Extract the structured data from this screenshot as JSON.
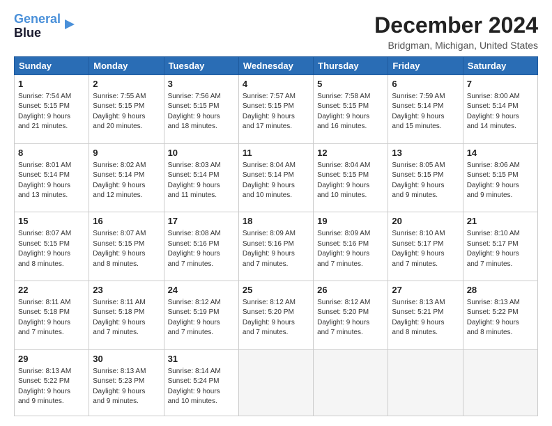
{
  "logo": {
    "line1": "General",
    "line2": "Blue"
  },
  "title": "December 2024",
  "subtitle": "Bridgman, Michigan, United States",
  "headers": [
    "Sunday",
    "Monday",
    "Tuesday",
    "Wednesday",
    "Thursday",
    "Friday",
    "Saturday"
  ],
  "weeks": [
    [
      {
        "day": "1",
        "lines": [
          "Sunrise: 7:54 AM",
          "Sunset: 5:15 PM",
          "Daylight: 9 hours",
          "and 21 minutes."
        ]
      },
      {
        "day": "2",
        "lines": [
          "Sunrise: 7:55 AM",
          "Sunset: 5:15 PM",
          "Daylight: 9 hours",
          "and 20 minutes."
        ]
      },
      {
        "day": "3",
        "lines": [
          "Sunrise: 7:56 AM",
          "Sunset: 5:15 PM",
          "Daylight: 9 hours",
          "and 18 minutes."
        ]
      },
      {
        "day": "4",
        "lines": [
          "Sunrise: 7:57 AM",
          "Sunset: 5:15 PM",
          "Daylight: 9 hours",
          "and 17 minutes."
        ]
      },
      {
        "day": "5",
        "lines": [
          "Sunrise: 7:58 AM",
          "Sunset: 5:15 PM",
          "Daylight: 9 hours",
          "and 16 minutes."
        ]
      },
      {
        "day": "6",
        "lines": [
          "Sunrise: 7:59 AM",
          "Sunset: 5:14 PM",
          "Daylight: 9 hours",
          "and 15 minutes."
        ]
      },
      {
        "day": "7",
        "lines": [
          "Sunrise: 8:00 AM",
          "Sunset: 5:14 PM",
          "Daylight: 9 hours",
          "and 14 minutes."
        ]
      }
    ],
    [
      {
        "day": "8",
        "lines": [
          "Sunrise: 8:01 AM",
          "Sunset: 5:14 PM",
          "Daylight: 9 hours",
          "and 13 minutes."
        ]
      },
      {
        "day": "9",
        "lines": [
          "Sunrise: 8:02 AM",
          "Sunset: 5:14 PM",
          "Daylight: 9 hours",
          "and 12 minutes."
        ]
      },
      {
        "day": "10",
        "lines": [
          "Sunrise: 8:03 AM",
          "Sunset: 5:14 PM",
          "Daylight: 9 hours",
          "and 11 minutes."
        ]
      },
      {
        "day": "11",
        "lines": [
          "Sunrise: 8:04 AM",
          "Sunset: 5:14 PM",
          "Daylight: 9 hours",
          "and 10 minutes."
        ]
      },
      {
        "day": "12",
        "lines": [
          "Sunrise: 8:04 AM",
          "Sunset: 5:15 PM",
          "Daylight: 9 hours",
          "and 10 minutes."
        ]
      },
      {
        "day": "13",
        "lines": [
          "Sunrise: 8:05 AM",
          "Sunset: 5:15 PM",
          "Daylight: 9 hours",
          "and 9 minutes."
        ]
      },
      {
        "day": "14",
        "lines": [
          "Sunrise: 8:06 AM",
          "Sunset: 5:15 PM",
          "Daylight: 9 hours",
          "and 9 minutes."
        ]
      }
    ],
    [
      {
        "day": "15",
        "lines": [
          "Sunrise: 8:07 AM",
          "Sunset: 5:15 PM",
          "Daylight: 9 hours",
          "and 8 minutes."
        ]
      },
      {
        "day": "16",
        "lines": [
          "Sunrise: 8:07 AM",
          "Sunset: 5:15 PM",
          "Daylight: 9 hours",
          "and 8 minutes."
        ]
      },
      {
        "day": "17",
        "lines": [
          "Sunrise: 8:08 AM",
          "Sunset: 5:16 PM",
          "Daylight: 9 hours",
          "and 7 minutes."
        ]
      },
      {
        "day": "18",
        "lines": [
          "Sunrise: 8:09 AM",
          "Sunset: 5:16 PM",
          "Daylight: 9 hours",
          "and 7 minutes."
        ]
      },
      {
        "day": "19",
        "lines": [
          "Sunrise: 8:09 AM",
          "Sunset: 5:16 PM",
          "Daylight: 9 hours",
          "and 7 minutes."
        ]
      },
      {
        "day": "20",
        "lines": [
          "Sunrise: 8:10 AM",
          "Sunset: 5:17 PM",
          "Daylight: 9 hours",
          "and 7 minutes."
        ]
      },
      {
        "day": "21",
        "lines": [
          "Sunrise: 8:10 AM",
          "Sunset: 5:17 PM",
          "Daylight: 9 hours",
          "and 7 minutes."
        ]
      }
    ],
    [
      {
        "day": "22",
        "lines": [
          "Sunrise: 8:11 AM",
          "Sunset: 5:18 PM",
          "Daylight: 9 hours",
          "and 7 minutes."
        ]
      },
      {
        "day": "23",
        "lines": [
          "Sunrise: 8:11 AM",
          "Sunset: 5:18 PM",
          "Daylight: 9 hours",
          "and 7 minutes."
        ]
      },
      {
        "day": "24",
        "lines": [
          "Sunrise: 8:12 AM",
          "Sunset: 5:19 PM",
          "Daylight: 9 hours",
          "and 7 minutes."
        ]
      },
      {
        "day": "25",
        "lines": [
          "Sunrise: 8:12 AM",
          "Sunset: 5:20 PM",
          "Daylight: 9 hours",
          "and 7 minutes."
        ]
      },
      {
        "day": "26",
        "lines": [
          "Sunrise: 8:12 AM",
          "Sunset: 5:20 PM",
          "Daylight: 9 hours",
          "and 7 minutes."
        ]
      },
      {
        "day": "27",
        "lines": [
          "Sunrise: 8:13 AM",
          "Sunset: 5:21 PM",
          "Daylight: 9 hours",
          "and 8 minutes."
        ]
      },
      {
        "day": "28",
        "lines": [
          "Sunrise: 8:13 AM",
          "Sunset: 5:22 PM",
          "Daylight: 9 hours",
          "and 8 minutes."
        ]
      }
    ],
    [
      {
        "day": "29",
        "lines": [
          "Sunrise: 8:13 AM",
          "Sunset: 5:22 PM",
          "Daylight: 9 hours",
          "and 9 minutes."
        ]
      },
      {
        "day": "30",
        "lines": [
          "Sunrise: 8:13 AM",
          "Sunset: 5:23 PM",
          "Daylight: 9 hours",
          "and 9 minutes."
        ]
      },
      {
        "day": "31",
        "lines": [
          "Sunrise: 8:14 AM",
          "Sunset: 5:24 PM",
          "Daylight: 9 hours",
          "and 10 minutes."
        ]
      },
      null,
      null,
      null,
      null
    ]
  ]
}
